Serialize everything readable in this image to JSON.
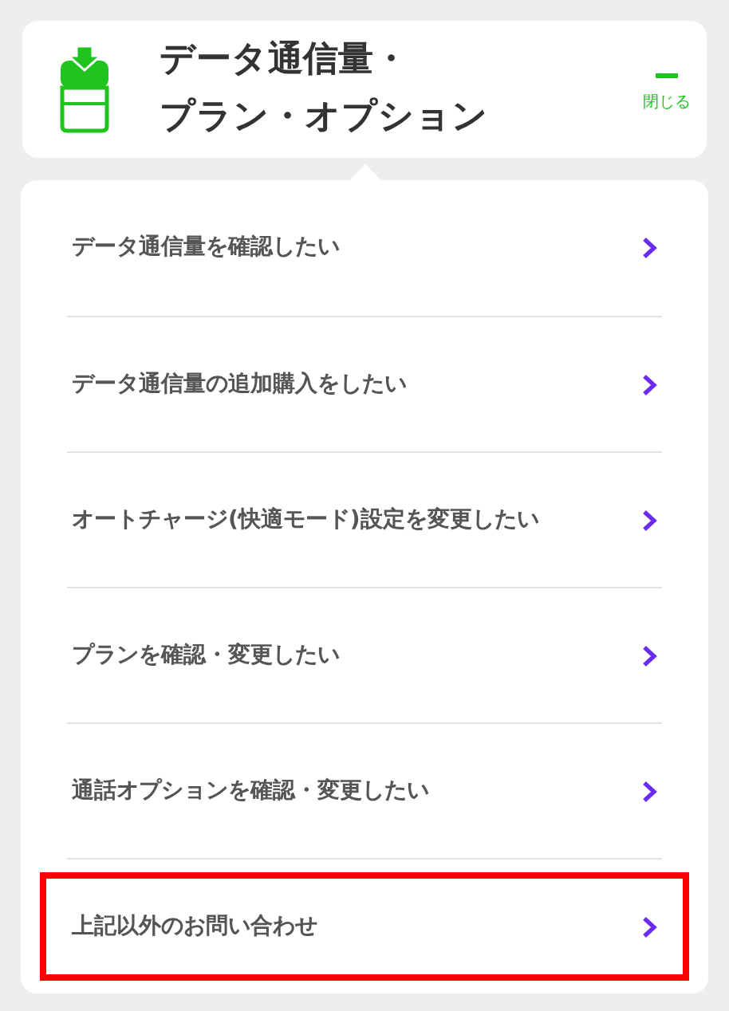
{
  "header": {
    "title_line_1": "データ通信量・",
    "title_line_2": "プラン・オプション",
    "close_label": "閉じる",
    "expanded": true
  },
  "items": [
    {
      "label": "データ通信量を確認したい",
      "highlighted": false
    },
    {
      "label": "データ通信量の追加購入をしたい",
      "highlighted": false
    },
    {
      "label": "オートチャージ(快適モード)設定を変更したい",
      "highlighted": false
    },
    {
      "label": "プランを確認・変更したい",
      "highlighted": false
    },
    {
      "label": "通話オプションを確認・変更したい",
      "highlighted": false
    },
    {
      "label": "上記以外のお問い合わせ",
      "highlighted": true
    }
  ]
}
